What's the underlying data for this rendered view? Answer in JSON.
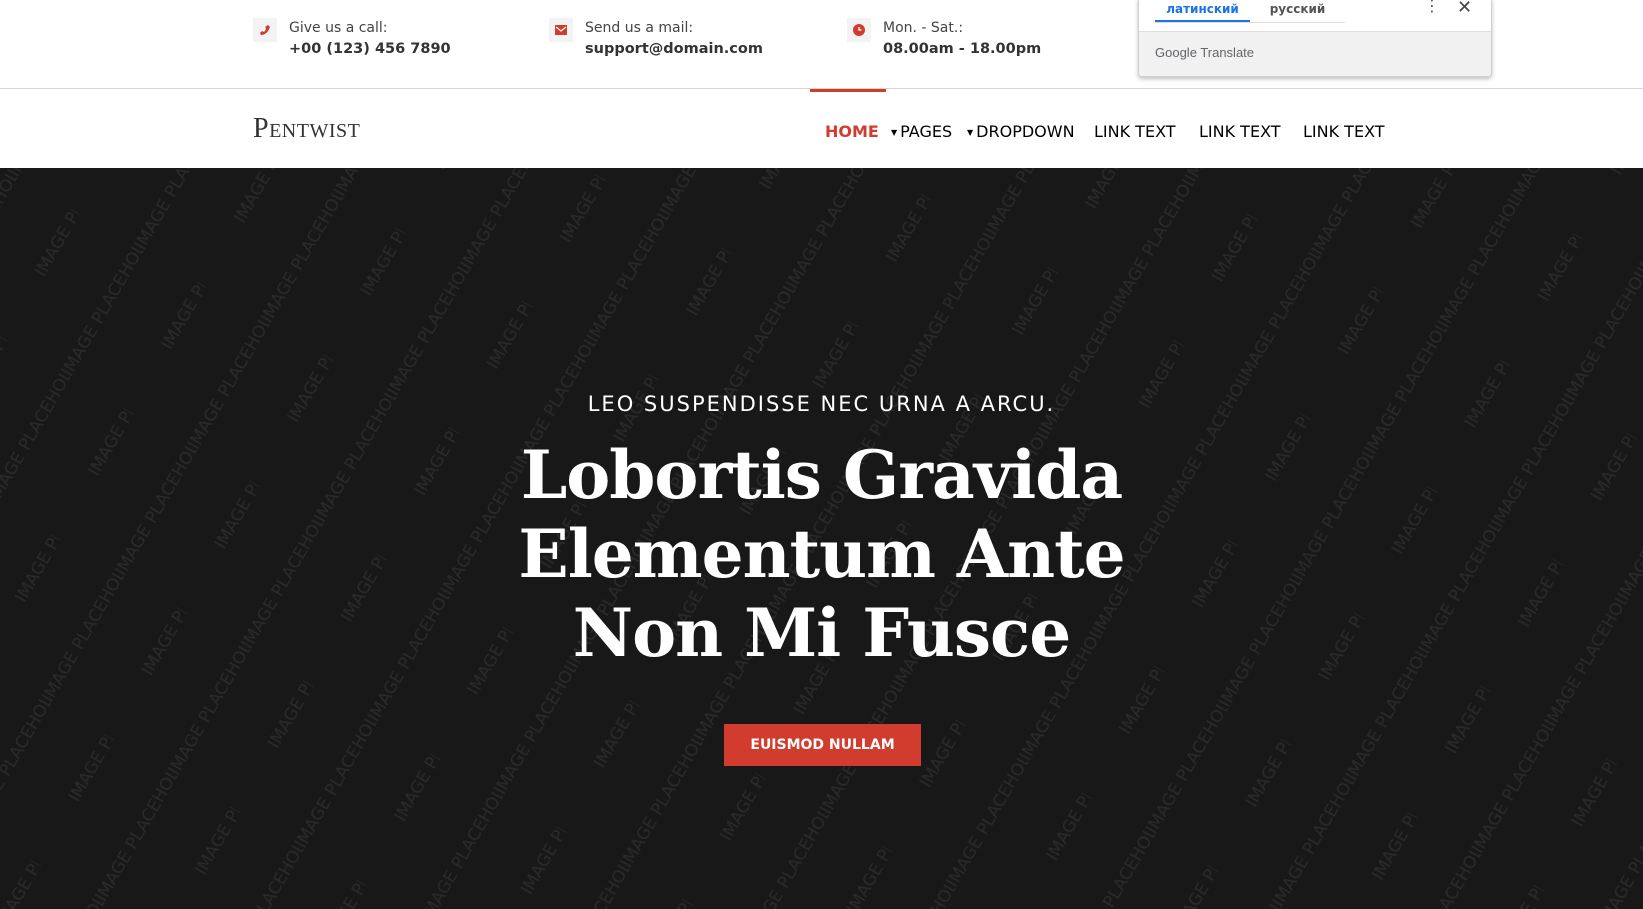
{
  "contacts": [
    {
      "icon": "phone-icon",
      "label": "Give us a call:",
      "value": "+00 (123) 456 7890"
    },
    {
      "icon": "mail-icon",
      "label": "Send us a mail:",
      "value": "support@domain.com"
    },
    {
      "icon": "clock-icon",
      "label": "Mon. - Sat.:",
      "value": "08.00am - 18.00pm"
    }
  ],
  "brand": "Pentwist",
  "nav": {
    "items": [
      {
        "label": "HOME",
        "active": true
      },
      {
        "label": "PAGES",
        "dropdown": true
      },
      {
        "label": "DROPDOWN",
        "dropdown": true
      },
      {
        "label": "LINK TEXT"
      },
      {
        "label": "LINK TEXT"
      },
      {
        "label": "LINK TEXT"
      }
    ]
  },
  "hero": {
    "subtitle": "LEO SUSPENDISSE NEC URNA A ARCU.",
    "title_lines": [
      "Lobortis Gravida",
      "Elementum Ante",
      "Non Mi Fusce"
    ],
    "cta": "EUISMOD NULLAM",
    "watermark": "IMAGE PLACEHOLDER"
  },
  "translate": {
    "tabs": [
      "латинский",
      "русский"
    ],
    "active_tab": 0,
    "brand_google": "Google",
    "brand_translate": "Translate"
  },
  "colors": {
    "accent": "#d13c2f",
    "hero_bg": "#181818",
    "translate_blue": "#1a73e8"
  }
}
